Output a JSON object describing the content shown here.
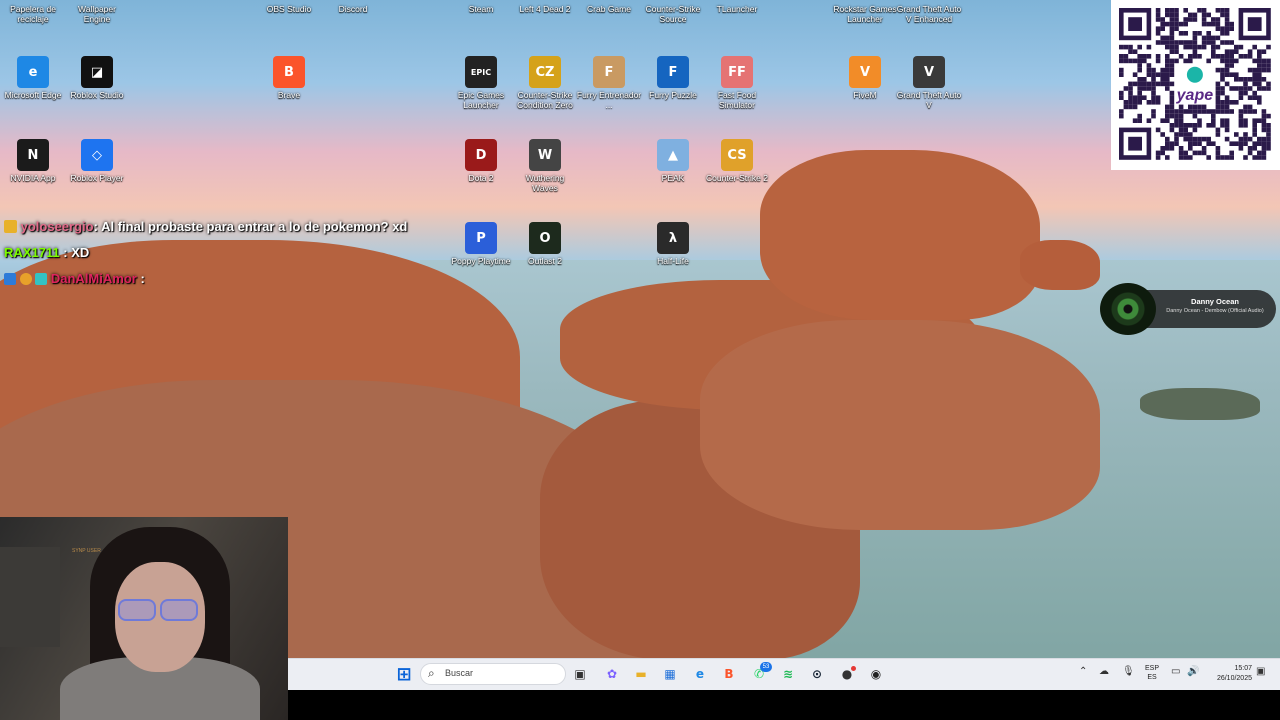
{
  "desktop": {
    "top_row": [
      {
        "label": "Papelera de reciclaje",
        "icon": "recycle-bin-icon"
      },
      {
        "label": "Wallpaper Engine",
        "icon": "wallpaper-engine-icon"
      },
      {
        "label": "OBS Studio",
        "icon": "obs-icon"
      },
      {
        "label": "Discord",
        "icon": "discord-icon"
      },
      {
        "label": "Steam",
        "icon": "steam-icon"
      },
      {
        "label": "Left 4 Dead 2",
        "icon": "left4dead2-icon"
      },
      {
        "label": "Crab Game",
        "icon": "crab-game-icon"
      },
      {
        "label": "Counter-Strike Source",
        "icon": "counter-strike-source-icon"
      },
      {
        "label": "TLauncher",
        "icon": "tlauncher-icon"
      },
      {
        "label": "Rockstar Games Launcher",
        "icon": "rockstar-icon"
      },
      {
        "label": "Grand Theft Auto V Enhanced",
        "icon": "gta-v-enhanced-icon"
      }
    ],
    "icons": [
      {
        "label": "Microsoft Edge",
        "glyph": "e",
        "color": "#1e88e5"
      },
      {
        "label": "Roblox Studio",
        "glyph": "◪",
        "color": "#111111"
      },
      {
        "label": "Brave",
        "glyph": "B",
        "color": "#fb542b"
      },
      {
        "label": "Epic Games Launcher",
        "glyph": "EPIC",
        "color": "#222222"
      },
      {
        "label": "Counter-Strike Condition Zero",
        "glyph": "CZ",
        "color": "#d5a21a"
      },
      {
        "label": "Furry Entrenador ...",
        "glyph": "F",
        "color": "#c99a62"
      },
      {
        "label": "Furry Puzzle",
        "glyph": "F",
        "color": "#1565c0"
      },
      {
        "label": "Fast Food Simulator",
        "glyph": "FF",
        "color": "#e57373"
      },
      {
        "label": "FiveM",
        "glyph": "V",
        "color": "#f28c28"
      },
      {
        "label": "Grand Theft Auto V",
        "glyph": "V",
        "color": "#3a3a3a"
      },
      {
        "label": "NVIDIA App",
        "glyph": "N",
        "color": "#1b1b1b"
      },
      {
        "label": "Roblox Player",
        "glyph": "◇",
        "color": "#1e74f0"
      },
      {
        "label": "Dota 2",
        "glyph": "D",
        "color": "#9a1a1a"
      },
      {
        "label": "Wuthering Waves",
        "glyph": "W",
        "color": "#444444"
      },
      {
        "label": "PEAK",
        "glyph": "▲",
        "color": "#7fb0e0"
      },
      {
        "label": "Counter-Strike 2",
        "glyph": "CS",
        "color": "#e0a12a"
      },
      {
        "label": "Poppy Playtime",
        "glyph": "P",
        "color": "#2b5fd9"
      },
      {
        "label": "Outlast 2",
        "glyph": "O",
        "color": "#1d2a1d"
      },
      {
        "label": "Half-Life",
        "glyph": "λ",
        "color": "#2a2a2a"
      }
    ]
  },
  "chat": [
    {
      "user": "yoloseergio",
      "sep": ":",
      "message": "Al final probaste para entrar a lo de pokemon? xd",
      "user_color": "#e36b8a",
      "msg_color": "#ffffff"
    },
    {
      "user": "RAX1711",
      "sep": ":",
      "message": "XD",
      "user_color": "#7cfc00",
      "msg_color": "#ffffff"
    },
    {
      "user": "DanAlMiAmor",
      "sep": ":",
      "message": "",
      "user_color": "#e0245e",
      "msg_color": "#ffffff"
    }
  ],
  "now_playing": {
    "artist": "Danny Ocean",
    "track": "Danny Ocean - Dembow (Official Audio)"
  },
  "qr": {
    "brand": "yape"
  },
  "webcam": {
    "caption": "SYNP USER"
  },
  "taskbar": {
    "search_placeholder": "Buscar",
    "apps": [
      {
        "name": "windows-start",
        "glyph": "⊞",
        "color": "#0a64d8"
      },
      {
        "name": "task-view",
        "glyph": "▣",
        "color": "#333333"
      },
      {
        "name": "copilot",
        "glyph": "✿",
        "color": "#7b61ff"
      },
      {
        "name": "file-explorer",
        "glyph": "▬",
        "color": "#e8b12a"
      },
      {
        "name": "store",
        "glyph": "▦",
        "color": "#1e6fd9"
      },
      {
        "name": "edge",
        "glyph": "e",
        "color": "#1e88e5"
      },
      {
        "name": "brave",
        "glyph": "B",
        "color": "#fb542b"
      },
      {
        "name": "whatsapp",
        "glyph": "✆",
        "color": "#25d366"
      },
      {
        "name": "spotify",
        "glyph": "≋",
        "color": "#1db954"
      },
      {
        "name": "steam",
        "glyph": "⊙",
        "color": "#1b2838"
      },
      {
        "name": "game-app",
        "glyph": "●",
        "color": "#333333"
      },
      {
        "name": "obs",
        "glyph": "◉",
        "color": "#222222"
      }
    ],
    "whatsapp_badge": "53",
    "language": "ESP",
    "layout": "ES",
    "time": "15:07",
    "date": "26/10/2025"
  }
}
